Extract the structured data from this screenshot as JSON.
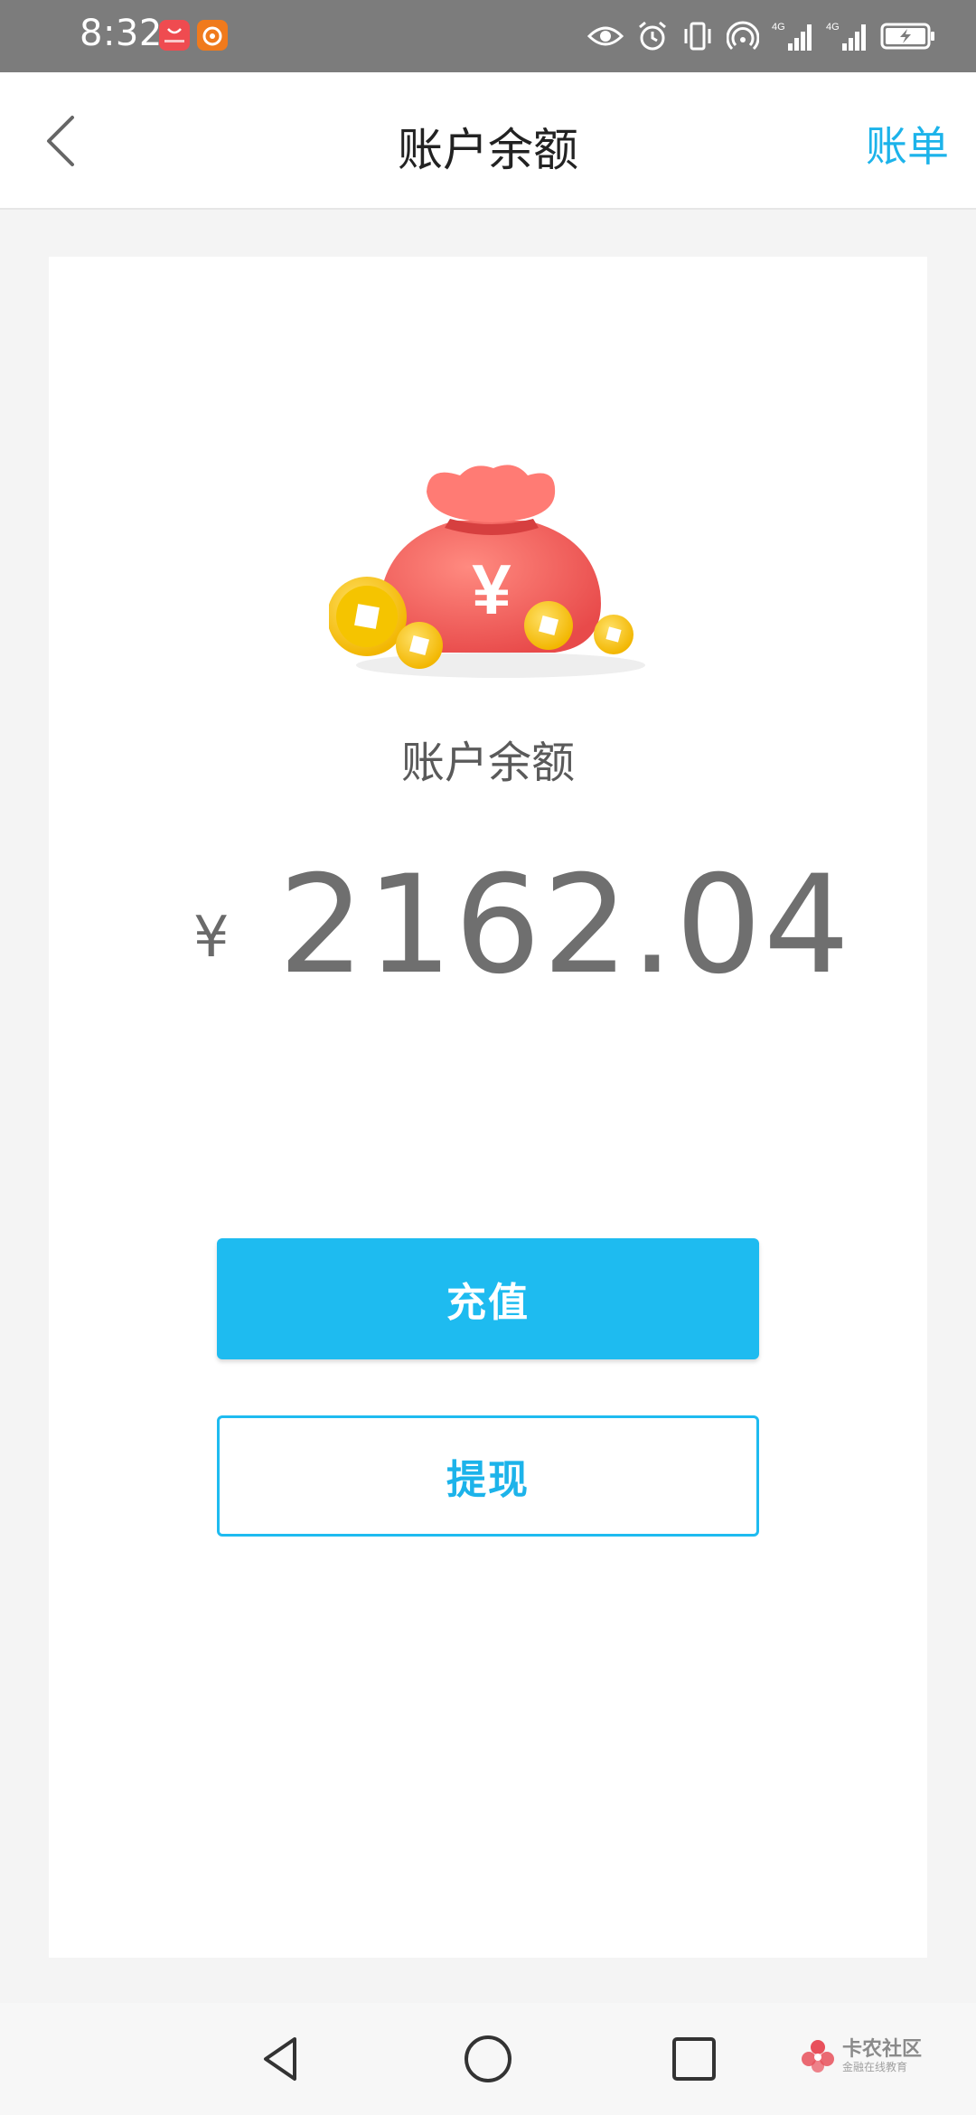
{
  "status_bar": {
    "time": "8:32",
    "icons": [
      "huawei-appgallery-icon",
      "app-notification-icon",
      "eye-icon",
      "alarm-icon",
      "vibrate-icon",
      "hotspot-icon",
      "signal-4g-icon",
      "signal-4g-icon",
      "battery-charging-icon"
    ],
    "net_label_1": "4G",
    "net_label_2": "4G"
  },
  "nav": {
    "back_icon": "chevron-left-icon",
    "title": "账户余额",
    "bill_link": "账单"
  },
  "balance": {
    "illustration": "money-bag-with-coins",
    "label": "账户余额",
    "currency_symbol": "¥",
    "amount": "2162.04",
    "bag_symbol": "¥"
  },
  "actions": {
    "recharge_label": "充值",
    "withdraw_label": "提现"
  },
  "system_nav": {
    "back": "triangle-back-icon",
    "home": "circle-home-icon",
    "recents": "square-recents-icon"
  },
  "watermark": {
    "main": "卡农社区",
    "sub": "金融在线教育"
  },
  "colors": {
    "accent": "#1ebbf0",
    "status_bar": "#7c7c7c",
    "background": "#f4f4f4",
    "bag_red": "#ef5b5b",
    "coin_gold": "#f7c600"
  }
}
